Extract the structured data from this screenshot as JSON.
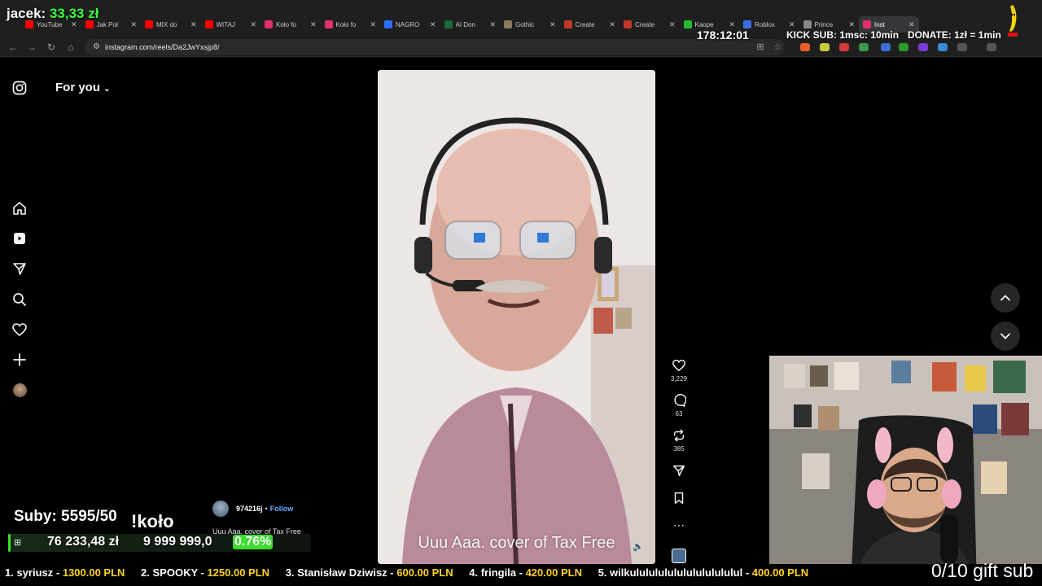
{
  "browser": {
    "tabs": [
      {
        "title": "YouTube",
        "favicon_color": "#ff0000"
      },
      {
        "title": "Jak Poł",
        "favicon_color": "#ff0000"
      },
      {
        "title": "MIX do",
        "favicon_color": "#ff0000"
      },
      {
        "title": "WITAJ",
        "favicon_color": "#ff0000"
      },
      {
        "title": "Koło fo",
        "favicon_color": "#e1306c"
      },
      {
        "title": "Koło fo",
        "favicon_color": "#e1306c"
      },
      {
        "title": "NAGRO",
        "favicon_color": "#2b6fff"
      },
      {
        "title": "AI Don",
        "favicon_color": "#1e6b37"
      },
      {
        "title": "Gothic",
        "favicon_color": "#8a7a5a"
      },
      {
        "title": "Create",
        "favicon_color": "#c0392b"
      },
      {
        "title": "Create",
        "favicon_color": "#c0392b"
      },
      {
        "title": "Kaope",
        "favicon_color": "#22bb33"
      },
      {
        "title": "Roblox",
        "favicon_color": "#3b6de0"
      },
      {
        "title": "Prince",
        "favicon_color": "#888888"
      },
      {
        "title": "Inst",
        "favicon_color": "#e1306c"
      }
    ],
    "url": "instagram.com/reels/Da2JwYxsjp8/"
  },
  "overlay": {
    "user_label": "jacek:",
    "user_amount": "33,33 zł",
    "timer": "178:12:01",
    "kick_sub": "KICK SUB: 1msc: 10min",
    "donate": "DONATE: 1zł = 1min",
    "subs": "Suby: 5595/50",
    "kolo": "!koło",
    "goal_current": "76 233,48 zł",
    "goal_target": "9 999 999,0",
    "goal_percent": "0.76%",
    "goal_progress": 0.0076,
    "gift_sub": "0/10 gift sub",
    "leaderboard": [
      {
        "name": "1. syriusz - ",
        "amount": "1300.00 PLN"
      },
      {
        "name": "2. SPOOKY - ",
        "amount": "1250.00 PLN"
      },
      {
        "name": "3. Stanisław Dziwisz - ",
        "amount": "600.00 PLN"
      },
      {
        "name": "4. fringila - ",
        "amount": "420.00 PLN"
      },
      {
        "name": "5. wilkulululululululululululul - ",
        "amount": "400.00 PLN"
      }
    ]
  },
  "instagram": {
    "header_title": "For you",
    "reel": {
      "caption_overlay": "Uuu Aaa. cover of Tax Free",
      "author": "974216j",
      "follow_label": "Follow",
      "description": "Uuu Aaa. cover of Tax Free",
      "likes": "3,229",
      "comments": "63",
      "reposts": "385"
    }
  }
}
